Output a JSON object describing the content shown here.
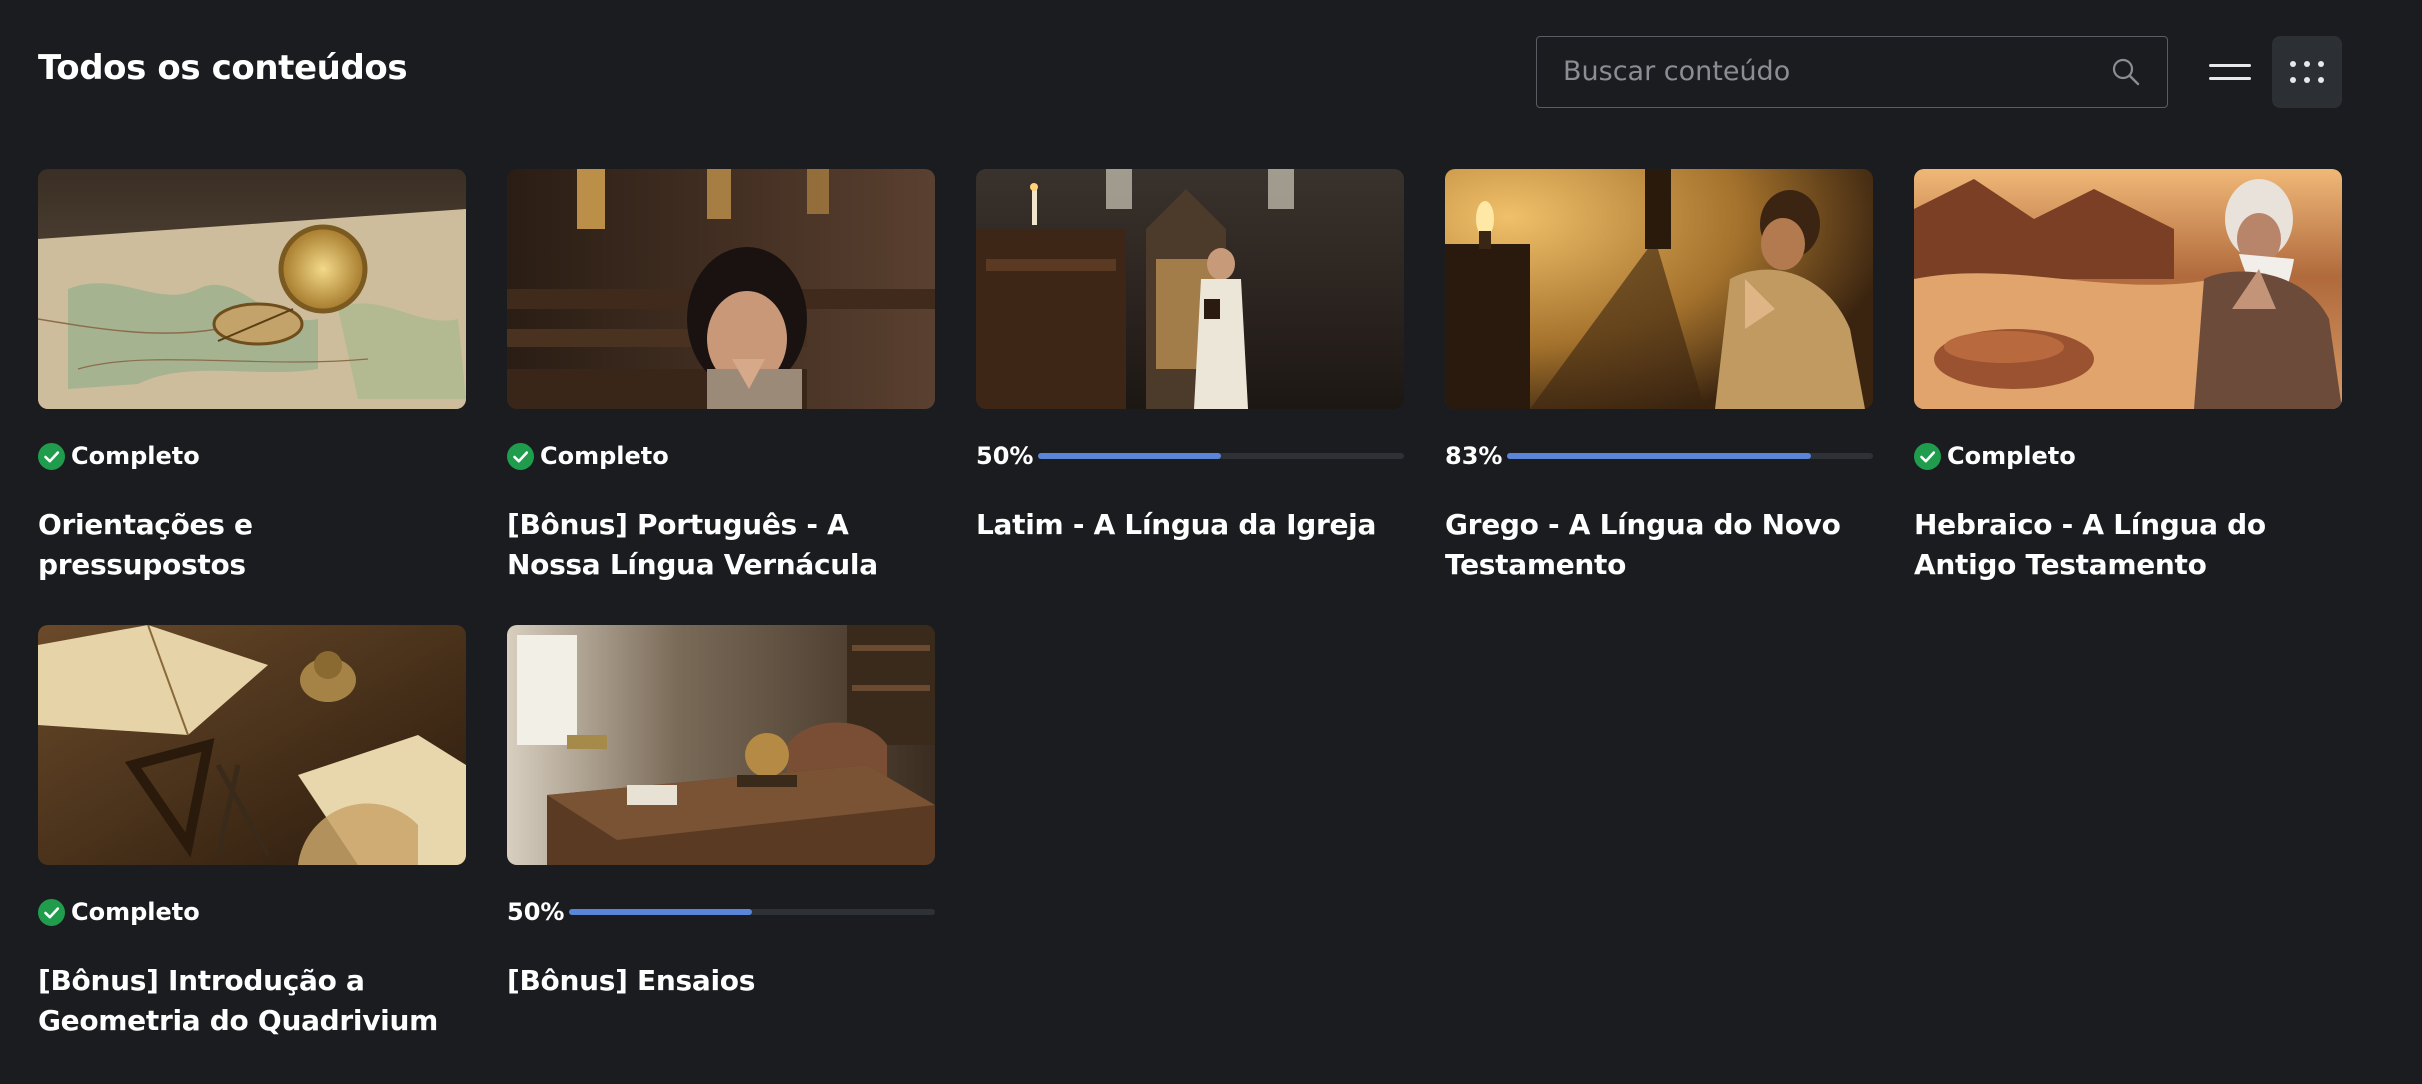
{
  "page": {
    "title": "Todos os conteúdos"
  },
  "search": {
    "placeholder": "Buscar conteúdo",
    "value": ""
  },
  "view_toggle": {
    "options": [
      "list-view-icon",
      "grid-view-icon"
    ],
    "selected": "grid"
  },
  "colors": {
    "background": "#1b1c20",
    "complete_green": "#1f9d4c",
    "progress_blue": "#5b85d9",
    "progress_track": "#2e3136"
  },
  "status_labels": {
    "complete": "Completo"
  },
  "courses": [
    {
      "title": "Orientações e pressupostos",
      "status": "Completo",
      "progress_percent": 100,
      "progress_label": "",
      "thumbnail": "map-with-compass"
    },
    {
      "title": "[Bônus] Português - A Nossa Língua Vernácula",
      "status": "Completo",
      "progress_percent": 100,
      "progress_label": "",
      "thumbnail": "child-praying-in-church"
    },
    {
      "title": "Latim - A Língua da Igreja",
      "status": "",
      "progress_percent": 50,
      "progress_label": "50%",
      "thumbnail": "altar-server-in-cathedral"
    },
    {
      "title": "Grego - A Língua do Novo Testamento",
      "status": "",
      "progress_percent": 83,
      "progress_label": "83%",
      "thumbnail": "man-praying-by-lamp"
    },
    {
      "title": "Hebraico - A Língua do Antigo Testamento",
      "status": "Completo",
      "progress_percent": 100,
      "progress_label": "",
      "thumbnail": "elder-praying-in-desert"
    },
    {
      "title": "[Bônus] Introdução a Geometria do Quadrivium",
      "status": "Completo",
      "progress_percent": 100,
      "progress_label": "",
      "thumbnail": "geometry-books-and-tools"
    },
    {
      "title": "[Bônus] Ensaios",
      "status": "",
      "progress_percent": 50,
      "progress_label": "50%",
      "thumbnail": "study-desk"
    }
  ]
}
